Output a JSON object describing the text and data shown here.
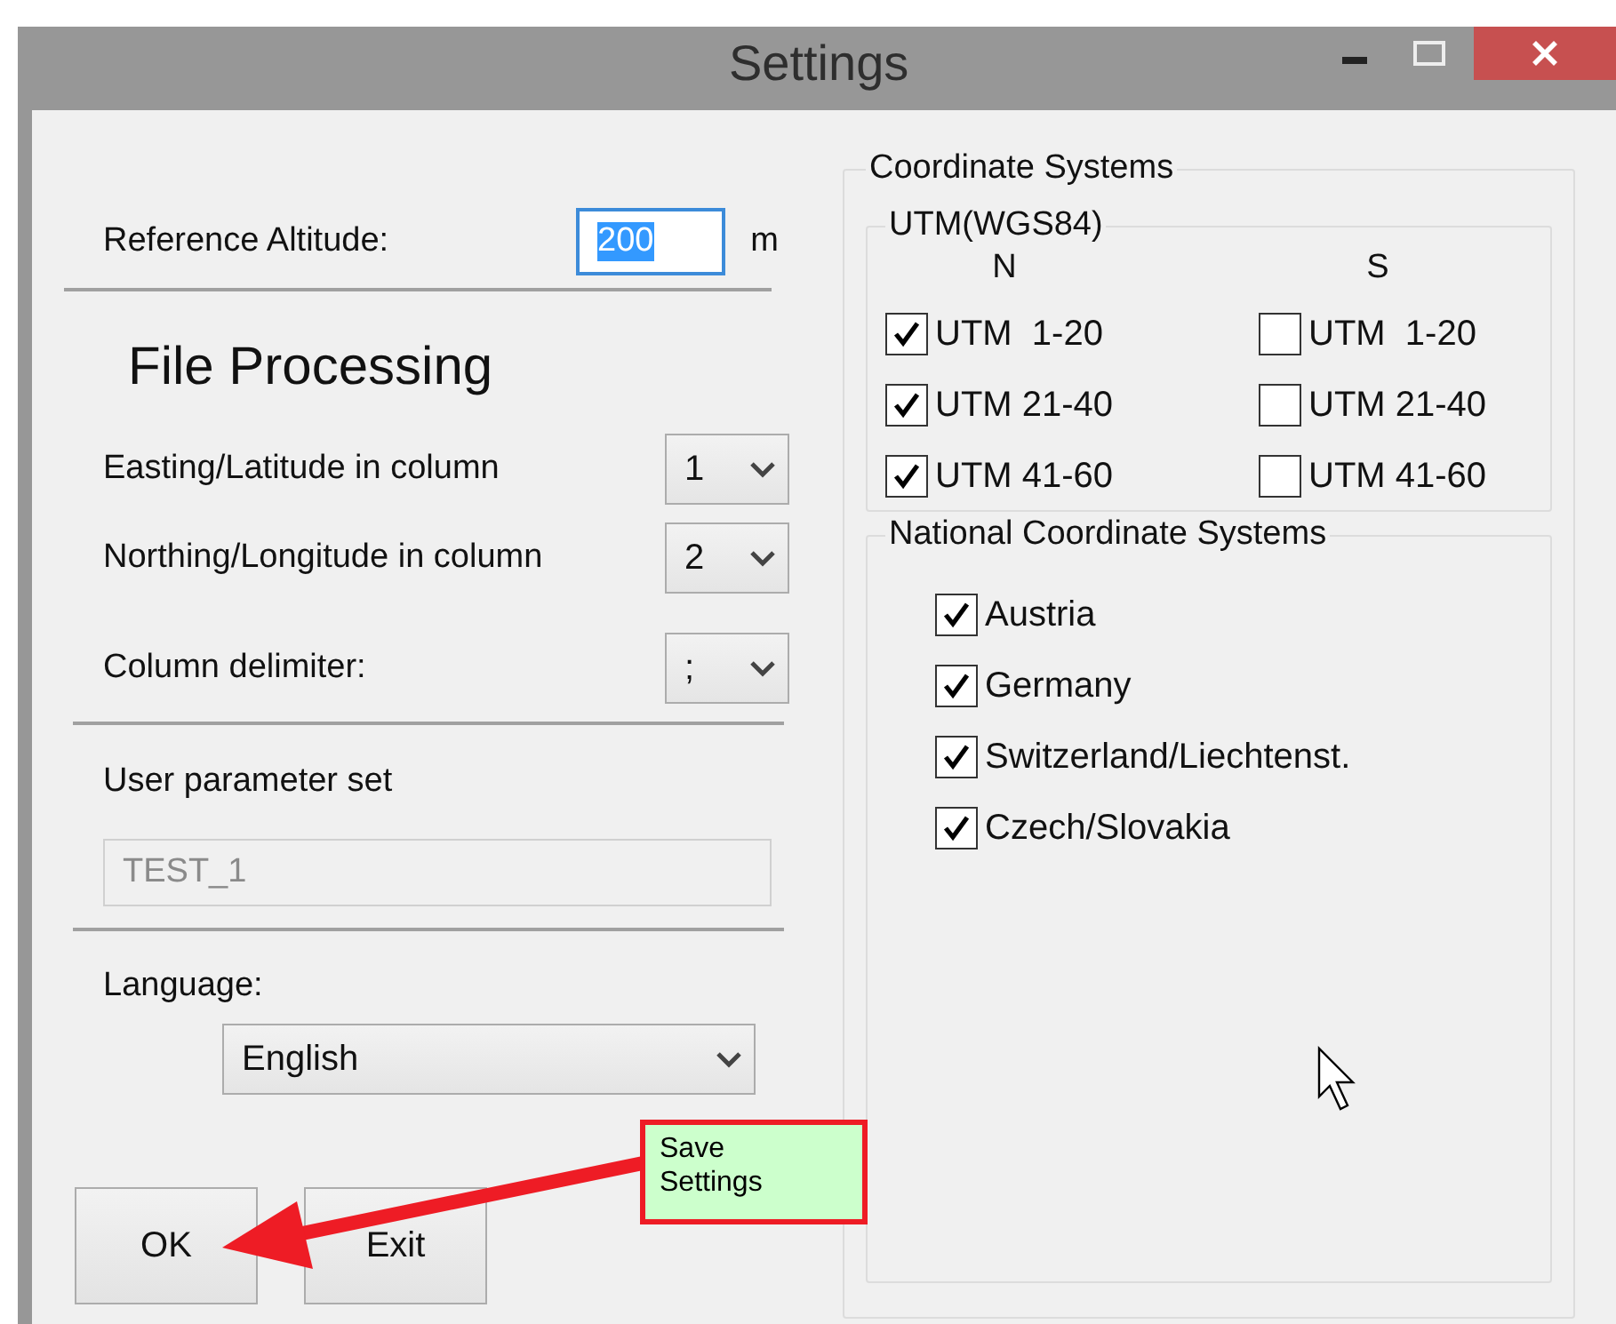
{
  "window": {
    "title": "Settings"
  },
  "reference_altitude": {
    "label": "Reference Altitude:",
    "value": "200",
    "value_selected": true,
    "unit": "m"
  },
  "file_processing": {
    "heading": "File Processing",
    "fields": [
      {
        "label": "Easting/Latitude in column",
        "value": "1"
      },
      {
        "label": "Northing/Longitude in column",
        "value": "2"
      },
      {
        "label": "Column delimiter:",
        "value": ";"
      }
    ]
  },
  "user_parameter_set": {
    "label": "User parameter set",
    "value": "TEST_1",
    "disabled": true
  },
  "language": {
    "label": "Language:",
    "value": "English"
  },
  "buttons": [
    "OK",
    "Exit"
  ],
  "coordinate_systems": {
    "title": "Coordinate Systems",
    "utm": {
      "title": "UTM(WGS84)",
      "columns": [
        {
          "heading": "N",
          "items": [
            {
              "label": "UTM  1-20",
              "checked": true
            },
            {
              "label": "UTM 21-40",
              "checked": true
            },
            {
              "label": "UTM 41-60",
              "checked": true
            }
          ]
        },
        {
          "heading": "S",
          "items": [
            {
              "label": "UTM  1-20",
              "checked": false
            },
            {
              "label": "UTM 21-40",
              "checked": false
            },
            {
              "label": "UTM 41-60",
              "checked": false
            }
          ]
        }
      ]
    },
    "national": {
      "title": "National Coordinate Systems",
      "items": [
        {
          "label": "Austria",
          "checked": true
        },
        {
          "label": "Germany",
          "checked": true
        },
        {
          "label": "Switzerland/Liechtenst.",
          "checked": true
        },
        {
          "label": "Czech/Slovakia",
          "checked": true
        }
      ]
    }
  },
  "annotation": {
    "text": "Save Settings"
  }
}
